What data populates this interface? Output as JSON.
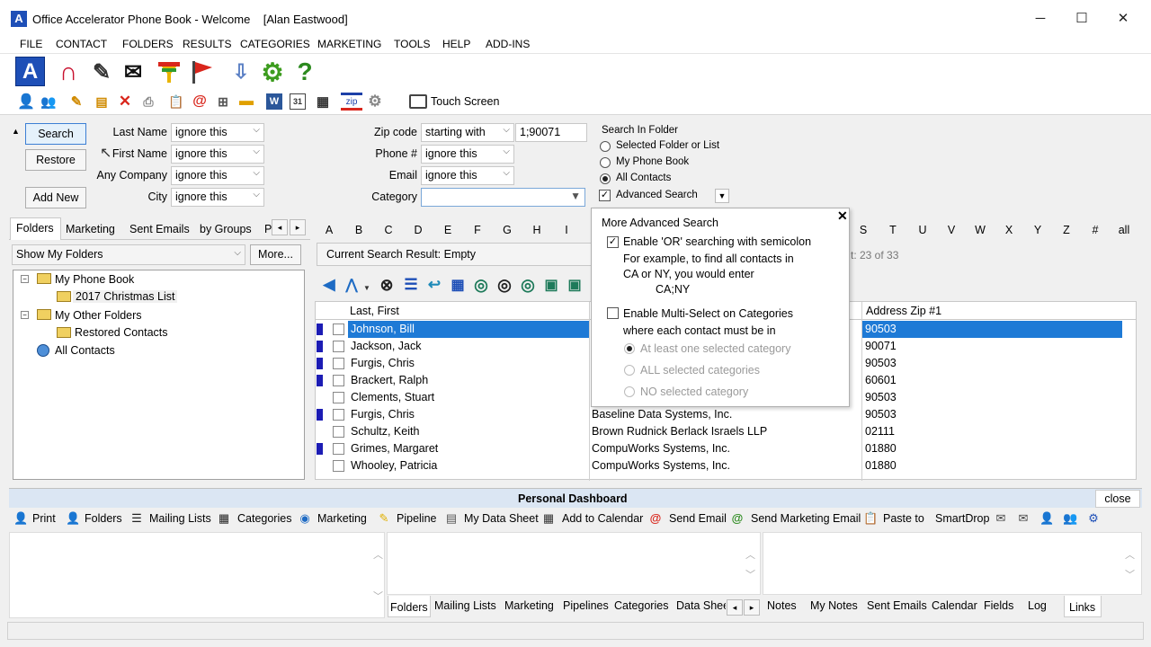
{
  "window": {
    "title": "Office Accelerator Phone Book - Welcome",
    "user": "[Alan Eastwood]",
    "minimize": "─",
    "maximize": "☐",
    "close": "✕"
  },
  "menu": [
    "FILE",
    "CONTACT",
    "FOLDERS",
    "RESULTS",
    "CATEGORIES",
    "MARKETING",
    "TOOLS",
    "HELP",
    "ADD-INS"
  ],
  "toolbar2": {
    "touch_screen": "Touch Screen",
    "zip_badge": "zip",
    "word_badge": "W",
    "calendar_badge": "31"
  },
  "search": {
    "search_btn": "Search",
    "restore_btn": "Restore",
    "add_new_btn": "Add New",
    "last_name_label": "Last Name",
    "last_name_value": "ignore this",
    "first_name_label": "First Name",
    "first_name_value": "ignore this",
    "company_label": "Any Company",
    "company_value": "ignore this",
    "city_label": "City",
    "city_value": "ignore this",
    "zip_label": "Zip code",
    "zip_mode": "starting with",
    "zip_value": "1;90071",
    "phone_label": "Phone #",
    "phone_value": "ignore this",
    "email_label": "Email",
    "email_value": "ignore this",
    "category_label": "Category",
    "category_value": ""
  },
  "search_in": {
    "title": "Search In Folder",
    "opt1": "Selected Folder or List",
    "opt2": "My Phone Book",
    "opt3": "All Contacts",
    "selected": "All Contacts",
    "advanced": "Advanced Search"
  },
  "left_tabs": [
    "Folders",
    "Marketing",
    "Sent Emails",
    "by Groups",
    "P"
  ],
  "show_folders": "Show My Folders",
  "more_btn": "More...",
  "tree": {
    "root": "My Phone Book",
    "child1": "2017 Christmas List",
    "root2": "My Other Folders",
    "child2": "Restored Contacts",
    "all": "All Contacts"
  },
  "letters_left": [
    "A",
    "B",
    "C",
    "D",
    "E",
    "F",
    "G",
    "H",
    "I"
  ],
  "letters_right": [
    "S",
    "T",
    "U",
    "V",
    "W",
    "X",
    "Y",
    "Z",
    "#",
    "all"
  ],
  "result_label": "Current Search Result: Empty",
  "count_label": "t: 23 of 33",
  "columns": {
    "name": "Last, First",
    "zip": "Address Zip #1"
  },
  "rows": [
    {
      "name": "Johnson, Bill",
      "company": "",
      "zip": "90503",
      "marker": true,
      "sel": true
    },
    {
      "name": "Jackson, Jack",
      "company": "",
      "zip": "90071",
      "marker": true,
      "sel": false
    },
    {
      "name": "Furgis, Chris",
      "company": "",
      "zip": "90503",
      "marker": true,
      "sel": false
    },
    {
      "name": "Brackert, Ralph",
      "company": "",
      "zip": "60601",
      "marker": true,
      "sel": false
    },
    {
      "name": "Clements, Stuart",
      "company": "",
      "zip": "90503",
      "marker": false,
      "sel": false
    },
    {
      "name": "Furgis, Chris",
      "company": "Baseline Data Systems, Inc.",
      "zip": "90503",
      "marker": true,
      "sel": false
    },
    {
      "name": "Schultz, Keith",
      "company": "Brown Rudnick Berlack Israels LLP",
      "zip": "02111",
      "marker": false,
      "sel": false
    },
    {
      "name": "Grimes, Margaret",
      "company": "CompuWorks Systems, Inc.",
      "zip": "01880",
      "marker": true,
      "sel": false
    },
    {
      "name": "Whooley, Patricia",
      "company": "CompuWorks Systems, Inc.",
      "zip": "01880",
      "marker": false,
      "sel": false
    }
  ],
  "popup": {
    "title": "More Advanced Search",
    "close": "✕",
    "or_label": "Enable 'OR' searching with semicolon",
    "or_help1": "For example, to find all contacts in",
    "or_help2": "CA or NY, you would enter",
    "or_help3": "CA;NY",
    "multi_label": "Enable Multi-Select on Categories",
    "multi_help": "where each contact must be in",
    "r1": "At least one selected category",
    "r2": "ALL selected categories",
    "r3": "NO selected category"
  },
  "dashboard": {
    "title": "Personal Dashboard",
    "close": "close",
    "items": [
      "Print",
      "Folders",
      "Mailing Lists",
      "Categories",
      "Marketing",
      "Pipeline",
      "My Data Sheet",
      "Add to Calendar",
      "Send Email",
      "Send Marketing Email",
      "Paste to",
      "SmartDrop"
    ]
  },
  "bottom_tabs_left": [
    "Folders",
    "Mailing Lists",
    "Marketing",
    "Pipelines",
    "Categories",
    "Data Shee"
  ],
  "bottom_tabs_right": [
    "Notes",
    "My Notes",
    "Sent Emails",
    "Calendar",
    "Fields",
    "Log",
    "Links"
  ],
  "colors": {
    "selection": "#1e7ad6",
    "marker": "#1c1cb4",
    "dash_header": "#dbe6f3"
  }
}
